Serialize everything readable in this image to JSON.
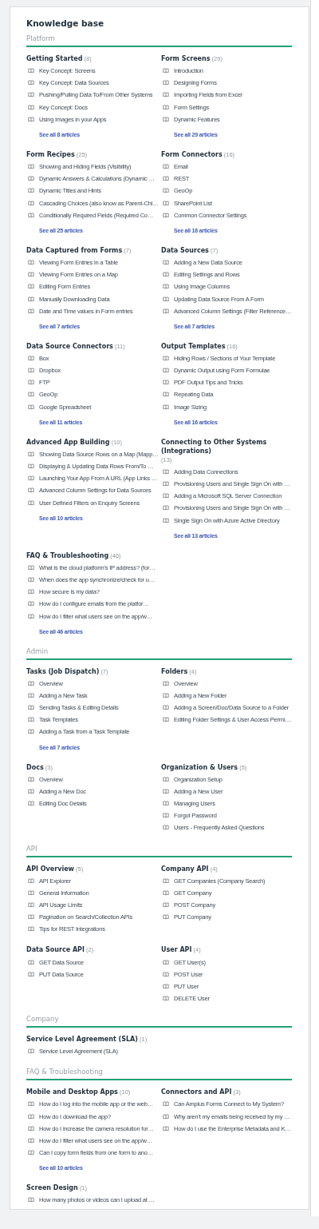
{
  "title": "Knowledge base",
  "sections": [
    {
      "title": "Platform",
      "categories": [
        {
          "title": "Getting Started",
          "count": "(8)",
          "articles": [
            "Key Concept: Screens",
            "Key Concept: Data Sources",
            "Pushing/Pulling Data To/From Other Systems",
            "Key Concept: Docs",
            "Using Images in your Apps"
          ],
          "see_all": "See all 8 articles"
        },
        {
          "title": "Form Screens",
          "count": "(29)",
          "articles": [
            "Introduction",
            "Designing Forms",
            "Importing Fields from Excel",
            "Form Settings",
            "Dynamic Features"
          ],
          "see_all": "See all 29 articles"
        },
        {
          "title": "Form Recipes",
          "count": "(25)",
          "articles": [
            "Showing and Hiding Fields (Visibility)",
            "Dynamic Answers & Calculations (Dynamic …",
            "Dynamic Titles and Hints",
            "Cascading Choices (also know as Parent-Chi…",
            "Conditionally Required Fields (Required Co…"
          ],
          "see_all": "See all 25 articles"
        },
        {
          "title": "Form Connectors",
          "count": "(16)",
          "articles": [
            "Email",
            "REST",
            "GeoOp",
            "SharePoint List",
            "Common Connector Settings"
          ],
          "see_all": "See all 16 articles"
        },
        {
          "title": "Data Captured from Forms",
          "count": "(7)",
          "articles": [
            "Viewing Form Entries in a Table",
            "Viewing Form Entries on a Map",
            "Editing Form Entries",
            "Manually Downloading Data",
            "Date and Time values in Form entries"
          ],
          "see_all": "See all 7 articles"
        },
        {
          "title": "Data Sources",
          "count": "(7)",
          "articles": [
            "Adding a New Data Source",
            "Editing Settings and Rows",
            "Using Image Columns",
            "Updating Data Source From A Form",
            "Advanced Column Settings (Filter Reference…"
          ],
          "see_all": "See all 7 articles"
        },
        {
          "title": "Data Source Connectors",
          "count": "(11)",
          "articles": [
            "Box",
            "Dropbox",
            "FTP",
            "GeoOp",
            "Google Spreadsheet"
          ],
          "see_all": "See all 11 articles"
        },
        {
          "title": "Output Templates",
          "count": "(16)",
          "articles": [
            "Hiding Rows / Sections of Your Template",
            "Dynamic Output using Form Formulae",
            "PDF Output Tips and Tricks",
            "Repeating Data",
            "Image Sizing"
          ],
          "see_all": "See all 16 articles"
        },
        {
          "title": "Advanced App Building",
          "count": "(10)",
          "articles": [
            "Showing Data Source Rows on a Map (Mapp…",
            "Displaying & Updating Data Rows From/To …",
            "Launching Your App From A URL (App Links …",
            "Advanced Column Settings for Data Sources",
            "User Defined Filters on Enquiry Screens"
          ],
          "see_all": "See all 10 articles"
        },
        {
          "title": "Connecting to Other Systems (Integrations)",
          "count": "(13)",
          "articles": [
            "Adding Data Connections",
            "Provisioning Users and Single Sign On with …",
            "Adding a Microsoft SQL Server Connection",
            "Provisioning Users and Single Sign On with …",
            "Single Sign On with Azure Active Directory"
          ],
          "see_all": "See all 13 articles"
        },
        {
          "title": "FAQ & Troubleshooting",
          "count": "(46)",
          "articles": [
            "What is the cloud platform's IP address? (for…",
            "When does the app synchronize/check for u…",
            "How secure is my data?",
            "How do I configure emails from the platfor…",
            "How do I filter what users see on the app/w…"
          ],
          "see_all": "See all 46 articles"
        }
      ]
    },
    {
      "title": "Admin",
      "categories": [
        {
          "title": "Tasks (Job Dispatch)",
          "count": "(7)",
          "articles": [
            "Overview",
            "Adding a New Task",
            "Sending Tasks & Editing Details",
            "Task Templates",
            "Adding a Task from a Task Template"
          ],
          "see_all": "See all 7 articles"
        },
        {
          "title": "Folders",
          "count": "(4)",
          "articles": [
            "Overview",
            "Adding a New Folder",
            "Adding a Screen/Doc/Data Source to a Folder",
            "Editing Folder Settings & User Access Permi…"
          ]
        },
        {
          "title": "Docs",
          "count": "(3)",
          "articles": [
            "Overview",
            "Adding a New Doc",
            "Editing Doc Details"
          ]
        },
        {
          "title": "Organization & Users",
          "count": "(5)",
          "articles": [
            "Organization Setup",
            "Adding a New User",
            "Managing Users",
            "Forgot Password",
            "Users - Frequently Asked Questions"
          ]
        }
      ]
    },
    {
      "title": "API",
      "categories": [
        {
          "title": "API Overview",
          "count": "(5)",
          "articles": [
            "API Explorer",
            "General Information",
            "API Usage Limits",
            "Pagination on Search/Collection APIs",
            "Tips for REST Integrations"
          ]
        },
        {
          "title": "Company API",
          "count": "(4)",
          "articles": [
            "GET Companies (Company Search)",
            "GET Company",
            "POST Company",
            "PUT Company"
          ]
        },
        {
          "title": "Data Source API",
          "count": "(2)",
          "articles": [
            "GET Data Source",
            "PUT Data Source"
          ]
        },
        {
          "title": "User API",
          "count": "(4)",
          "articles": [
            "GET User(s)",
            "POST User",
            "PUT User",
            "DELETE User"
          ]
        }
      ]
    },
    {
      "title": "Company",
      "categories": [
        {
          "title": "Service Level Agreement (SLA)",
          "count": "(1)",
          "articles": [
            "Service Level Agreement (SLA)"
          ]
        }
      ]
    },
    {
      "title": "FAQ & Troubleshooting",
      "categories": [
        {
          "title": "Mobile and Desktop Apps",
          "count": "(10)",
          "articles": [
            "How do I log into the mobile app or the web…",
            "How do I download the app?",
            "How do I increase the camera resolution for…",
            "How do I filter what users see on the app/w…",
            "Can I copy form fields from one form to ano…"
          ],
          "see_all": "See all 10 articles"
        },
        {
          "title": "Connectors and API",
          "count": "(3)",
          "articles": [
            "Can Amplus Forms Connect to My System?",
            "Why aren't my emails being received by my …",
            "How do I use the Enterprise Metadata and K…"
          ]
        },
        {
          "title": "Screen Design",
          "count": "(1)",
          "articles": [
            "How many photos or videos can I upload at …"
          ]
        }
      ]
    }
  ]
}
